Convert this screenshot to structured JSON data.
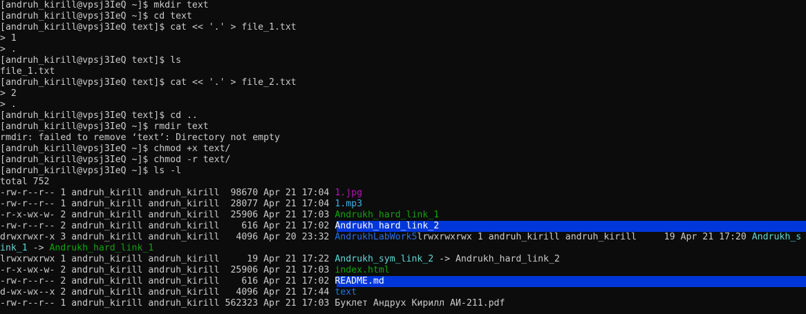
{
  "terminal": {
    "lines": [
      {
        "segments": [
          {
            "text": "[andruh_kirill@vpsj3IeQ ~]$ mkdir text",
            "color": "default"
          }
        ]
      },
      {
        "segments": [
          {
            "text": "[andruh_kirill@vpsj3IeQ ~]$ cd text",
            "color": "default"
          }
        ]
      },
      {
        "segments": [
          {
            "text": "[andruh_kirill@vpsj3IeQ text]$ cat << '.' > file_1.txt",
            "color": "default"
          }
        ]
      },
      {
        "segments": [
          {
            "text": "> 1",
            "color": "default"
          }
        ]
      },
      {
        "segments": [
          {
            "text": "> .",
            "color": "default"
          }
        ]
      },
      {
        "segments": [
          {
            "text": "[andruh_kirill@vpsj3IeQ text]$ ls",
            "color": "default"
          }
        ]
      },
      {
        "segments": [
          {
            "text": "file_1.txt",
            "color": "default"
          }
        ]
      },
      {
        "segments": [
          {
            "text": "[andruh_kirill@vpsj3IeQ text]$ cat << '.' > file_2.txt",
            "color": "default"
          }
        ]
      },
      {
        "segments": [
          {
            "text": "> 2",
            "color": "default"
          }
        ]
      },
      {
        "segments": [
          {
            "text": "> .",
            "color": "default"
          }
        ]
      },
      {
        "segments": [
          {
            "text": "[andruh_kirill@vpsj3IeQ text]$ cd ..",
            "color": "default"
          }
        ]
      },
      {
        "segments": [
          {
            "text": "[andruh_kirill@vpsj3IeQ ~]$ rmdir text",
            "color": "default"
          }
        ]
      },
      {
        "segments": [
          {
            "text": "rmdir: failed to remove ‘text’: Directory not empty",
            "color": "default"
          }
        ]
      },
      {
        "segments": [
          {
            "text": "[andruh_kirill@vpsj3IeQ ~]$ chmod +x text/",
            "color": "default"
          }
        ]
      },
      {
        "segments": [
          {
            "text": "[andruh_kirill@vpsj3IeQ ~]$ chmod -r text/",
            "color": "default"
          }
        ]
      },
      {
        "segments": [
          {
            "text": "[andruh_kirill@vpsj3IeQ ~]$ ls -l",
            "color": "default"
          }
        ]
      },
      {
        "segments": [
          {
            "text": "total 752",
            "color": "default"
          }
        ]
      },
      {
        "segments": [
          {
            "text": "-rw-r--r-- 1 andruh_kirill andruh_kirill  98670 Apr 21 17:04 ",
            "color": "default"
          },
          {
            "text": "1.jpg",
            "color": "magenta"
          }
        ]
      },
      {
        "segments": [
          {
            "text": "-rw-r--r-- 1 andruh_kirill andruh_kirill  28077 Apr 21 17:04 ",
            "color": "default"
          },
          {
            "text": "1.mp3",
            "color": "cyan"
          }
        ]
      },
      {
        "segments": [
          {
            "text": "-r-x-wx-w- 2 andruh_kirill andruh_kirill  25906 Apr 21 17:03 ",
            "color": "default"
          },
          {
            "text": "Andrukh_hard_link_1",
            "color": "green"
          }
        ]
      },
      {
        "highlight": true,
        "segments": [
          {
            "text": "-rw-r--r-- 2 andruh_kirill andruh_kirill    616 Apr 21 17:02 ",
            "color": "default"
          },
          {
            "text": "Andrukh_hard_link_2",
            "color": "hl"
          }
        ]
      },
      {
        "segments": [
          {
            "text": "drwxrwxr-x 3 andruh_kirill andruh_kirill   4096 Apr 20 23:32 ",
            "color": "default"
          },
          {
            "text": "AndrukhLabWork5",
            "color": "blue"
          },
          {
            "text": "lrwxrwxrwx 1 andruh_kirill andruh_kirill     19 Apr 21 17:20 ",
            "color": "default"
          },
          {
            "text": "Andrukh_s",
            "color": "bcyan"
          }
        ]
      },
      {
        "segments": [
          {
            "text": "ink_1",
            "color": "bcyan"
          },
          {
            "text": " -> ",
            "color": "default"
          },
          {
            "text": "Andrukh_hard_link_1",
            "color": "green"
          }
        ]
      },
      {
        "segments": [
          {
            "text": "lrwxrwxrwx 1 andruh_kirill andruh_kirill     19 Apr 21 17:22 ",
            "color": "default"
          },
          {
            "text": "Andrukh_sym_link_2",
            "color": "bcyan"
          },
          {
            "text": " -> Andrukh_hard_link_2",
            "color": "default"
          }
        ]
      },
      {
        "segments": [
          {
            "text": "-r-x-wx-w- 2 andruh_kirill andruh_kirill  25906 Apr 21 17:03 ",
            "color": "default"
          },
          {
            "text": "index.html",
            "color": "green"
          }
        ]
      },
      {
        "highlight": true,
        "segments": [
          {
            "text": "-rw-r--r-- 2 andruh_kirill andruh_kirill    616 Apr 21 17:02 ",
            "color": "default"
          },
          {
            "text": "README.md",
            "color": "hl"
          }
        ]
      },
      {
        "segments": [
          {
            "text": "d-wx-wx--x 2 andruh_kirill andruh_kirill   4096 Apr 21 17:44 ",
            "color": "default"
          },
          {
            "text": "text",
            "color": "blue"
          }
        ]
      },
      {
        "segments": [
          {
            "text": "-rw-r--r-- 1 andruh_kirill andruh_kirill 562323 Apr 21 17:03 Буклет Андрух Кирилл АИ-211.pdf",
            "color": "default"
          }
        ]
      }
    ],
    "colors": {
      "background": "#0c0c0c",
      "default": "#cccccc",
      "magenta": "#b516b4",
      "cyan": "#3ab4de",
      "green": "#13a10e",
      "blue": "#2a6fe6",
      "bcyan": "#61d6d6",
      "highlight": "#0037da"
    }
  }
}
